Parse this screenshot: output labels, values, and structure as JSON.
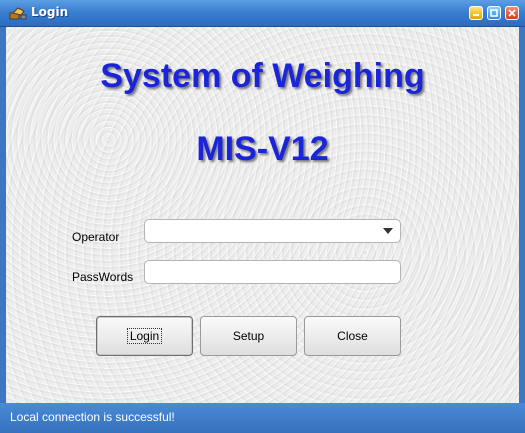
{
  "window": {
    "title": "Login",
    "title_icon": "app-icon",
    "controls": [
      "minimize-icon",
      "maximize-icon",
      "close-icon"
    ]
  },
  "header": {
    "line1": "System of Weighing",
    "line2": "MIS-V12",
    "color": "#1a24d8"
  },
  "form": {
    "operator_label": "Operator",
    "operator_value": "",
    "password_label": "PassWords",
    "password_value": ""
  },
  "buttons": {
    "login": "Login",
    "setup": "Setup",
    "close": "Close"
  },
  "status": {
    "text": "Local connection is successful!"
  },
  "colors": {
    "titlebar": "#3a7fd0",
    "statusbar": "#3a78c2"
  }
}
